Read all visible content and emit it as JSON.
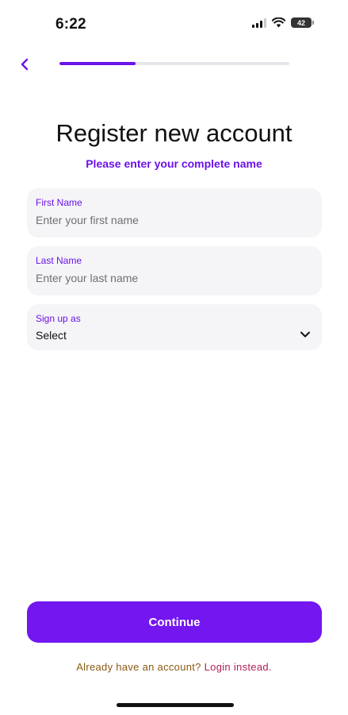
{
  "status_bar": {
    "time": "6:22",
    "battery_level": "42",
    "icons": [
      "cellular-signal-icon",
      "wifi-icon",
      "battery-icon"
    ]
  },
  "nav": {
    "back_icon": "chevron-left-icon",
    "progress_fraction": 0.33
  },
  "header": {
    "title": "Register new account",
    "subtitle": "Please enter your complete name"
  },
  "form": {
    "first_name": {
      "label": "First Name",
      "value": "",
      "placeholder": "Enter your first name"
    },
    "last_name": {
      "label": "Last Name",
      "value": "",
      "placeholder": "Enter your last name"
    },
    "sign_up_as": {
      "label": "Sign up as",
      "selected": "Select",
      "icon": "chevron-down-icon"
    }
  },
  "actions": {
    "continue_label": "Continue",
    "login_prompt": "Already have an account?",
    "login_link": "Login instead."
  },
  "colors": {
    "accent": "#6b12e8",
    "button": "#7316f0",
    "field_bg": "#f5f5f7",
    "prompt_text": "#8a5a12",
    "login_link": "#b0205a"
  }
}
